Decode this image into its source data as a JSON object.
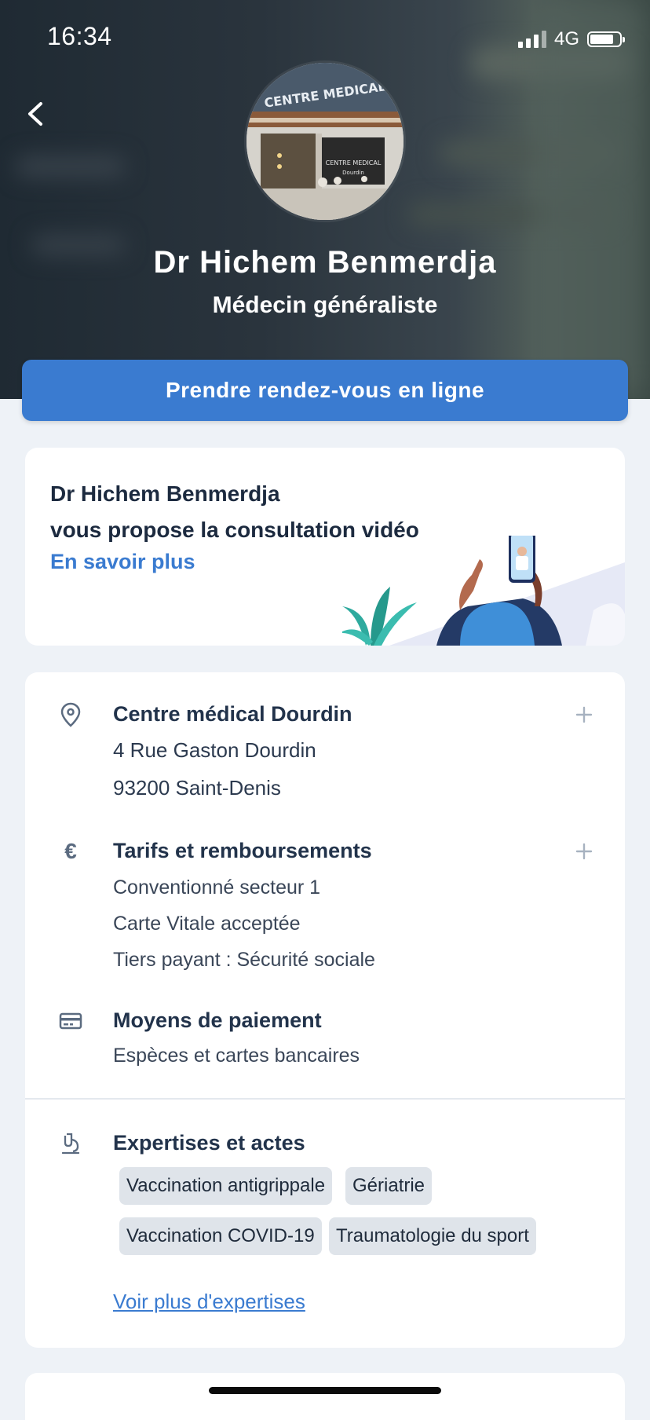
{
  "status_bar": {
    "time": "16:34",
    "network": "4G"
  },
  "doctor": {
    "name": "Dr Hichem Benmerdja",
    "specialty": "Médecin généraliste",
    "avatar_sign_text": "CENTRE MEDICAL",
    "avatar_window_text": "CENTRE MEDICAL Dourdin"
  },
  "cta": {
    "label": "Prendre rendez-vous en ligne"
  },
  "video_card": {
    "line1": "Dr Hichem Benmerdja",
    "line2": "vous propose la consultation vidéo",
    "link": "En savoir plus"
  },
  "location": {
    "title": "Centre médical Dourdin",
    "address1": "4 Rue Gaston Dourdin",
    "address2": "93200 Saint-Denis"
  },
  "tarifs": {
    "title": "Tarifs et remboursements",
    "lines": [
      "Conventionné secteur 1",
      "Carte Vitale acceptée",
      "Tiers payant : Sécurité sociale"
    ]
  },
  "paiement": {
    "title": "Moyens de paiement",
    "line": "Espèces et cartes bancaires"
  },
  "expertises": {
    "title": "Expertises et actes",
    "chips": [
      "Vaccination antigrippale",
      "Gériatrie",
      "Vaccination COVID-19",
      "Traumatologie du sport"
    ],
    "more_link": "Voir plus d'expertises"
  },
  "colors": {
    "primary": "#3a7bd0",
    "background": "#eef2f7",
    "text": "#1c2a3f"
  },
  "icons": {
    "back": "chevron-left-icon",
    "location": "map-pin-icon",
    "tarifs": "euro-icon",
    "paiement": "credit-card-icon",
    "expertises": "microscope-icon",
    "expand": "plus-icon"
  }
}
